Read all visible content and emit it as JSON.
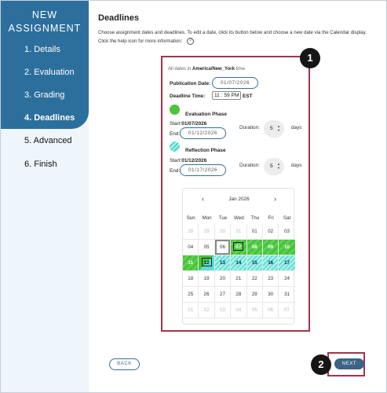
{
  "sidebar": {
    "title_line1": "NEW",
    "title_line2": "ASSIGNMENT",
    "items": [
      {
        "label": "1. Details"
      },
      {
        "label": "2. Evaluation"
      },
      {
        "label": "3. Grading"
      },
      {
        "label": "4. Deadlines"
      },
      {
        "label": "5. Advanced"
      },
      {
        "label": "6. Finish"
      }
    ]
  },
  "main": {
    "title": "Deadlines",
    "description": "Choose assignment dates and deadlines. To edit a date, click its button below and choose a new date via the Calendar display. Click the help icon for more information:",
    "help_icon": "?"
  },
  "panel": {
    "timezone_prefix": "All dates in ",
    "timezone": "America/New_York",
    "timezone_suffix": " time",
    "publication_label": "Publication Date:",
    "publication_date": "01/07/2026",
    "deadline_label": "Deadline Time:",
    "deadline_hour": "11",
    "deadline_minute": "59",
    "deadline_ampm": "PM",
    "deadline_tz": "EST",
    "evaluation": {
      "name": "Evaluation Phase",
      "start_label": "Start:",
      "start": "01/07/2026",
      "end_label": "End:",
      "end": "01/12/2026",
      "duration_label": "Duration:",
      "duration": "5",
      "days_label": "days"
    },
    "reflection": {
      "name": "Reflection Phase",
      "start_label": "Start:",
      "start": "01/12/2026",
      "end_label": "End:",
      "end": "01/17/2026",
      "duration_label": "Duration:",
      "duration": "5",
      "days_label": "days"
    }
  },
  "calendar": {
    "prev": "‹",
    "next": "›",
    "month": "Jan 2026",
    "weekdays": [
      "Sun",
      "Mon",
      "Tue",
      "Wed",
      "Thu",
      "Fri",
      "Sat"
    ],
    "weeks": [
      [
        "28",
        "29",
        "30",
        "31",
        "01",
        "02",
        "03"
      ],
      [
        "04",
        "05",
        "06",
        "07",
        "08",
        "09",
        "10"
      ],
      [
        "11",
        "12",
        "13",
        "14",
        "15",
        "16",
        "17"
      ],
      [
        "18",
        "19",
        "20",
        "21",
        "22",
        "23",
        "24"
      ],
      [
        "25",
        "26",
        "27",
        "28",
        "29",
        "30",
        "31"
      ],
      [
        "01",
        "02",
        "03",
        "04",
        "05",
        "06",
        "07"
      ]
    ]
  },
  "buttons": {
    "back": "BACK",
    "next": "NEXT"
  },
  "annotations": {
    "badge1": "1",
    "badge2": "2"
  }
}
